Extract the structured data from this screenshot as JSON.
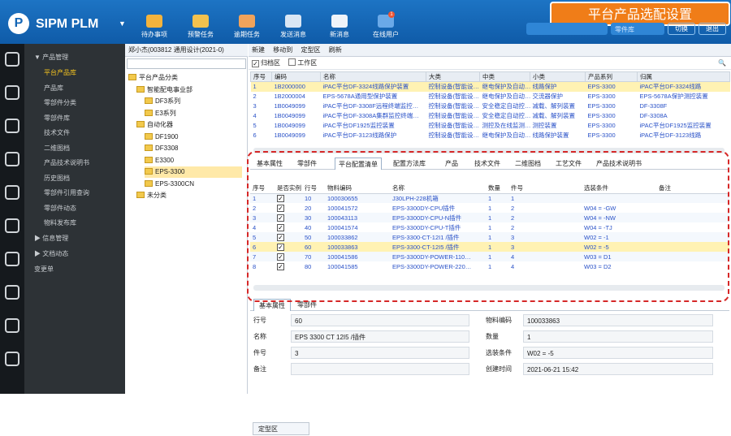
{
  "header": {
    "logo": "P",
    "brand": "SIPM PLM",
    "toolbar": [
      {
        "label": "待办事项",
        "icon": "todo-icon",
        "color": "#f3b33d"
      },
      {
        "label": "预警任务",
        "icon": "warning-task-icon",
        "color": "#f2c14e"
      },
      {
        "label": "逾期任务",
        "icon": "overdue-task-icon",
        "color": "#f0a35b"
      },
      {
        "label": "发送消息",
        "icon": "send-message-icon",
        "color": "#d9e6f4"
      },
      {
        "label": "新消息",
        "icon": "new-message-icon",
        "color": "#eef3f9"
      },
      {
        "label": "在线用户",
        "icon": "online-users-icon",
        "color": "#6aa9e8",
        "badge": "1"
      }
    ],
    "banner": "平台产品选配设置",
    "select_placeholder": "零件库",
    "buttons": [
      "切换",
      "退出"
    ]
  },
  "rail_icons": [
    "compass-icon",
    "home-icon",
    "edit-icon",
    "database-icon",
    "clipboard-icon",
    "loading-icon",
    "document-icon",
    "settings-icon",
    "book-icon",
    "upload-icon"
  ],
  "sidebar": {
    "groups": [
      {
        "label": "产品管理",
        "expanded": true,
        "items": [
          "平台产品库",
          "产品库",
          "零部件分类",
          "零部件库",
          "技术文件",
          "二维图档",
          "产品技术说明书",
          "历史图档",
          "零部件引用查询",
          "零部件动态",
          "物料发布库"
        ]
      },
      {
        "label": "信息管理",
        "expanded": false,
        "items": []
      },
      {
        "label": "文档动态",
        "expanded": false,
        "items": []
      }
    ],
    "extra": "变更单",
    "active": "平台产品库"
  },
  "tree": {
    "breadcrumb": "郑小杰(003812 通用设计(2021-0)",
    "nodes": [
      {
        "label": "平台产品分类",
        "level": 0
      },
      {
        "label": "智能配电事业部",
        "level": 1
      },
      {
        "label": "DF3系列",
        "level": 2
      },
      {
        "label": "E3系列",
        "level": 2
      },
      {
        "label": "自动化器",
        "level": 1
      },
      {
        "label": "DF1900",
        "level": 2
      },
      {
        "label": "DF3308",
        "level": 2
      },
      {
        "label": "E3300",
        "level": 2
      },
      {
        "label": "EPS-3300",
        "level": 2,
        "selected": true
      },
      {
        "label": "EPS-3300CN",
        "level": 2
      },
      {
        "label": "未分类",
        "level": 1
      }
    ],
    "bottom_tab": "定型区"
  },
  "main": {
    "toolbar": [
      "新建",
      "移动到",
      "定型区",
      "刷新"
    ],
    "filters": [
      {
        "label": "归档区",
        "checked": true
      },
      {
        "label": "工作区",
        "checked": false
      }
    ],
    "product_columns": [
      "序号",
      "编码",
      "名称",
      "大类",
      "中类",
      "小类",
      "产品系列",
      "归属"
    ],
    "products": [
      [
        "1",
        "1B2000000",
        "iPAC平台DF-3324线路保护装置",
        "控制设备(智能设…",
        "继电保护及自动…",
        "线路保护",
        "EPS-3300",
        "iPAC平台DF-3324线路"
      ],
      [
        "2",
        "1B2000004",
        "EPS-5678A通用型保护装置",
        "控制设备(智能设…",
        "继电保护及自动…",
        "交流器保护",
        "EPS-3300",
        "EPS-5678A保护测控装置"
      ],
      [
        "3",
        "1B0049099",
        "iPAC平台DF-3308F远程终端监控…",
        "控制设备(智能设…",
        "安全稳定自动控…",
        "减载、解列装置",
        "EPS-3300",
        "DF-3308F"
      ],
      [
        "4",
        "1B0049099",
        "iPAC平台DF-3308A集群监控终端…",
        "控制设备(智能设…",
        "安全稳定自动控…",
        "减载、解列装置",
        "EPS-3300",
        "DF-3308A"
      ],
      [
        "5",
        "1B0049099",
        "iPAC平台DF1925监控装置",
        "控制设备(智能设…",
        "测控及在线监测…",
        "测控装置",
        "EPS-3300",
        "iPAC平台DF1925监控装置"
      ],
      [
        "6",
        "1B0049099",
        "iPAC平台DF-3123线路保护",
        "控制设备(智能设…",
        "继电保护及自动…",
        "线路保护装置",
        "EPS-3300",
        "iPAC平台DF-3123线路"
      ]
    ],
    "tabs": [
      "基本属性",
      "零部件",
      "平台配置清单",
      "配置方法库",
      "产品",
      "技术文件",
      "二维图档",
      "工艺文件",
      "产品技术说明书"
    ],
    "active_tab": "平台配置清单",
    "config_columns": [
      "序号",
      "是否实例",
      "行号",
      "物料编码",
      "名称",
      "数量",
      "件号",
      "选装条件",
      "备注"
    ],
    "config_rows": [
      {
        "no": "1",
        "inst": true,
        "line": "10",
        "code": "100030655",
        "name": "J30LPH-228机箱",
        "qty": "1",
        "part": "1",
        "cond": "",
        "note": ""
      },
      {
        "no": "2",
        "inst": true,
        "line": "20",
        "code": "100041572",
        "name": "EPS-3300DY-CPU插件",
        "qty": "1",
        "part": "2",
        "cond": "W04 = -GW",
        "note": ""
      },
      {
        "no": "3",
        "inst": true,
        "line": "30",
        "code": "100043113",
        "name": "EPS-3300DY-CPU-N插件",
        "qty": "1",
        "part": "2",
        "cond": "W04 = -NW",
        "note": ""
      },
      {
        "no": "4",
        "inst": true,
        "line": "40",
        "code": "100041574",
        "name": "EPS-3300DY-CPU-T插件",
        "qty": "1",
        "part": "2",
        "cond": "W04 = -TJ",
        "note": ""
      },
      {
        "no": "5",
        "inst": true,
        "line": "50",
        "code": "100033862",
        "name": "EPS-3300-CT-12I1 /插件",
        "qty": "1",
        "part": "3",
        "cond": "W02 = -1",
        "note": ""
      },
      {
        "no": "6",
        "inst": true,
        "line": "60",
        "code": "100033863",
        "name": "EPS-3300-CT-12I5 /插件",
        "qty": "1",
        "part": "3",
        "cond": "W02 = -5",
        "note": "",
        "selected": true
      },
      {
        "no": "7",
        "inst": true,
        "line": "70",
        "code": "100041586",
        "name": "EPS-3300DY-POWER-110…",
        "qty": "1",
        "part": "4",
        "cond": "W03 = D1",
        "note": ""
      },
      {
        "no": "8",
        "inst": true,
        "line": "80",
        "code": "100041585",
        "name": "EPS-3300DY-POWER-220…",
        "qty": "1",
        "part": "4",
        "cond": "W03 = D2",
        "note": ""
      }
    ],
    "detail_tabs": [
      "基本属性",
      "零部件"
    ],
    "detail": {
      "line_label": "行号",
      "line_value": "60",
      "code_label": "物料编码",
      "code_value": "100033863",
      "name_label": "名称",
      "name_value": "EPS 3300 CT 12I5 /插件",
      "qty_label": "数量",
      "qty_value": "1",
      "part_label": "件号",
      "part_value": "3",
      "cond_label": "选装条件",
      "cond_value": "W02 = -5",
      "note_label": "备注",
      "note_value": "",
      "time_label": "创建时间",
      "time_value": "2021-06-21 15:42"
    }
  }
}
